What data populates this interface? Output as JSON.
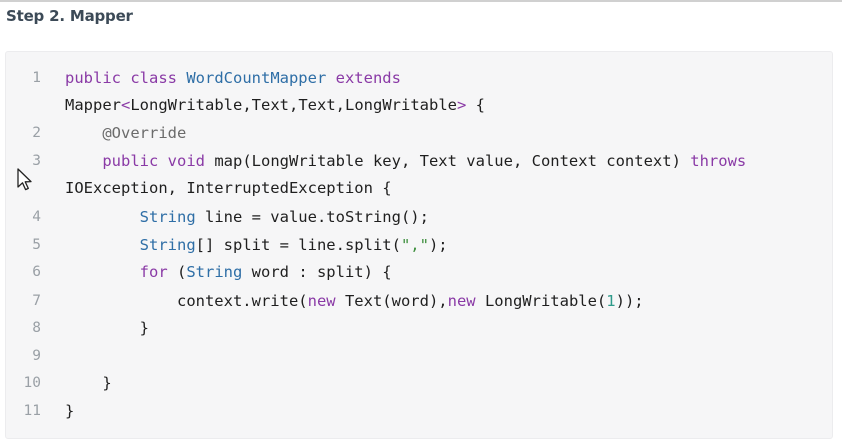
{
  "heading": "Step 2. Mapper",
  "code": {
    "line_numbers": [
      "1",
      "2",
      "3",
      "4",
      "5",
      "6",
      "7",
      "8",
      "9",
      "10",
      "11"
    ],
    "lines": [
      [
        {
          "t": "public ",
          "c": "kw"
        },
        {
          "t": "class ",
          "c": "kw"
        },
        {
          "t": "WordCountMapper ",
          "c": "ty"
        },
        {
          "t": "extends",
          "c": "kw"
        }
      ],
      [
        {
          "t": "Mapper",
          "c": "pl"
        },
        {
          "t": "<",
          "c": "kw"
        },
        {
          "t": "LongWritable",
          "c": "pl"
        },
        {
          "t": ",",
          "c": "pl"
        },
        {
          "t": "Text",
          "c": "pl"
        },
        {
          "t": ",",
          "c": "pl"
        },
        {
          "t": "Text",
          "c": "pl"
        },
        {
          "t": ",",
          "c": "pl"
        },
        {
          "t": "LongWritable",
          "c": "pl"
        },
        {
          "t": "> ",
          "c": "kw"
        },
        {
          "t": "{",
          "c": "pl"
        }
      ],
      [
        {
          "t": "    ",
          "c": "pl"
        },
        {
          "t": "@Override",
          "c": "an"
        }
      ],
      [
        {
          "t": "    ",
          "c": "pl"
        },
        {
          "t": "public ",
          "c": "kw"
        },
        {
          "t": "void ",
          "c": "kw"
        },
        {
          "t": "map(LongWritable key, Text value, Context context) ",
          "c": "pl"
        },
        {
          "t": "throws",
          "c": "kw"
        }
      ],
      [
        {
          "t": "IOException, InterruptedException {",
          "c": "pl"
        }
      ],
      [
        {
          "t": "        ",
          "c": "pl"
        },
        {
          "t": "String ",
          "c": "ty"
        },
        {
          "t": "line = value.toString();",
          "c": "pl"
        }
      ],
      [
        {
          "t": "        ",
          "c": "pl"
        },
        {
          "t": "String",
          "c": "ty"
        },
        {
          "t": "[] split = line.split(",
          "c": "pl"
        },
        {
          "t": "\",\"",
          "c": "st"
        },
        {
          "t": ");",
          "c": "pl"
        }
      ],
      [
        {
          "t": "        ",
          "c": "pl"
        },
        {
          "t": "for ",
          "c": "kw"
        },
        {
          "t": "(",
          "c": "pl"
        },
        {
          "t": "String ",
          "c": "ty"
        },
        {
          "t": "word : split) {",
          "c": "pl"
        }
      ],
      [
        {
          "t": "            ",
          "c": "pl"
        },
        {
          "t": "context.write(",
          "c": "pl"
        },
        {
          "t": "new ",
          "c": "kw"
        },
        {
          "t": "Text(word),",
          "c": "pl"
        },
        {
          "t": "new ",
          "c": "kw"
        },
        {
          "t": "LongWritable(",
          "c": "pl"
        },
        {
          "t": "1",
          "c": "nu"
        },
        {
          "t": "));",
          "c": "pl"
        }
      ],
      [
        {
          "t": "        }",
          "c": "pl"
        }
      ],
      [
        {
          "t": "",
          "c": "pl"
        }
      ],
      [
        {
          "t": "    }",
          "c": "pl"
        }
      ],
      [
        {
          "t": "}",
          "c": "pl"
        }
      ]
    ]
  }
}
